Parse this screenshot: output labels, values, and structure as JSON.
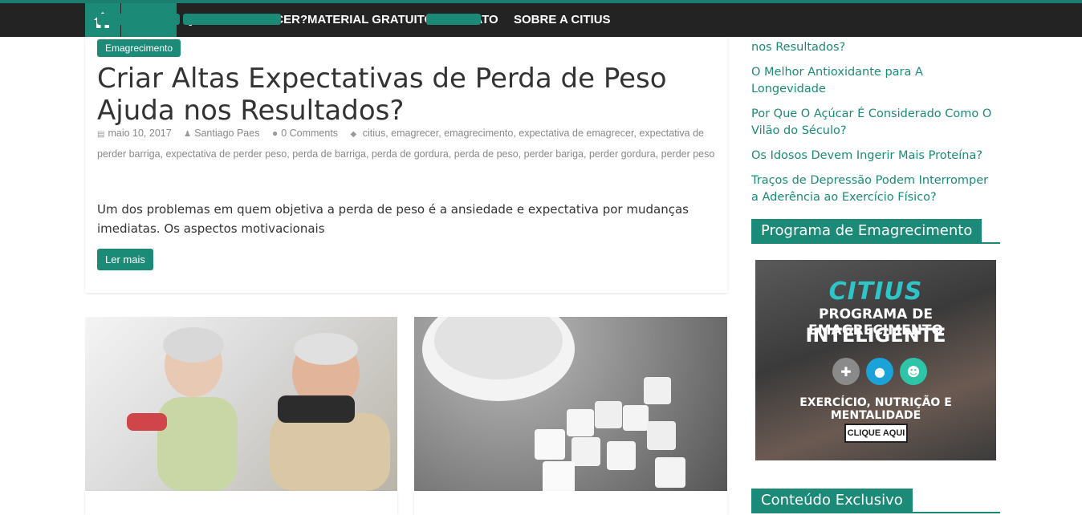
{
  "nav": {
    "home_icon": "home-icon",
    "items": [
      "HOME",
      "QUER EMAGRECER?",
      "MATERIAL GRATUITO",
      "CONTATO",
      "SOBRE A CITIUS"
    ]
  },
  "post": {
    "category": "Emagrecimento",
    "title": "Criar Altas Expectativas de Perda de Peso Ajuda nos Resultados?",
    "date": "maio 10, 2017",
    "author": "Santiago Paes",
    "comments": "0 Comments",
    "tags": [
      "citius",
      "emagrecer",
      "emagrecimento",
      "expectativa de emagrecer",
      "expectativa de perder barriga",
      "expectativa de perder peso",
      "perda de barriga",
      "perda de gordura",
      "perda de peso",
      "perder bariga",
      "perder gordura",
      "perder peso"
    ],
    "excerpt": "Um dos problemas em quem objetiva a perda de peso é a ansiedade e expectativa por mudanças imediatas. Os aspectos motivacionais",
    "read_more": "Ler mais"
  },
  "sidebar": {
    "links": [
      "nos Resultados?",
      "O Melhor Antioxidante para A Longevidade",
      "Por Que O Açúcar É Considerado Como O Vilão do Século?",
      "Os Idosos Devem Ingerir Mais Proteína?",
      "Traços de Depressão Podem Interromper a Aderência ao Exercício Físico?"
    ],
    "widget1_title": "Programa de Emagrecimento",
    "widget2_title": "Conteúdo Exclusivo",
    "promo": {
      "logo": "CITIUS",
      "line1": "PROGRAMA DE EMAGRECIMENTO",
      "line2": "INTELIGENTE",
      "line3": "EXERCÍCIO, NUTRIÇÃO E MENTALIDADE",
      "cta": "CLIQUE AQUI"
    }
  },
  "colors": {
    "accent": "#1b8a77",
    "navbar": "#232323"
  }
}
